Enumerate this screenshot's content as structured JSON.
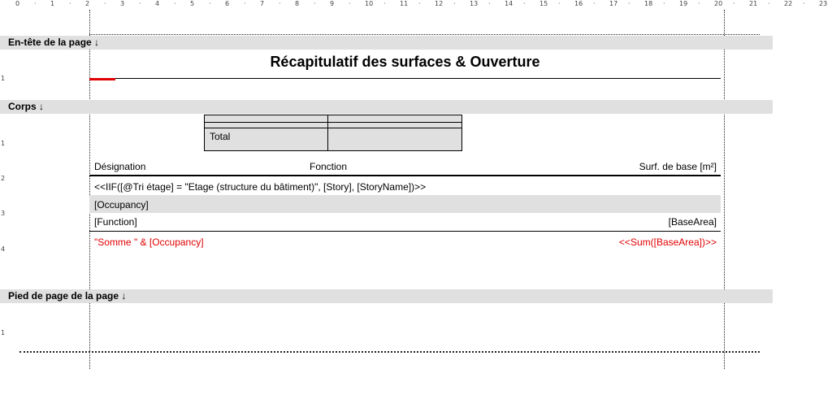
{
  "ruler": {
    "top_labels": [
      "0",
      "1",
      "2",
      "3",
      "4",
      "5",
      "6",
      "7",
      "8",
      "9",
      "10",
      "11",
      "12",
      "13",
      "14",
      "15",
      "16",
      "17",
      "18",
      "19",
      "20",
      "21",
      "22",
      "23"
    ],
    "left_labels": [
      "1",
      "1",
      "2",
      "3",
      "4",
      "1"
    ]
  },
  "sections": {
    "header_label": "En-tête de la page ↓",
    "body_label": "Corps ↓",
    "footer_label": "Pied de page de la page ↓"
  },
  "report": {
    "title": "Récapitulatif des surfaces & Ouverture",
    "summary_table": {
      "total_label": "Total"
    },
    "columns": {
      "designation": "Désignation",
      "fonction": "Fonction",
      "surf_base": "Surf. de base [m²]"
    },
    "group_expression": "<<IIF([@Tri étage] = \"Etage (structure du bâtiment)\", [Story], [StoryName])>>",
    "occupancy_field": "[Occupancy]",
    "function_field": "[Function]",
    "basearea_field": "[BaseArea]",
    "sum_label": "\"Somme \" & [Occupancy]",
    "sum_value": "<<Sum([BaseArea])>>"
  },
  "colors": {
    "band": "#e0e0e0",
    "accent_red": "#e00000"
  }
}
